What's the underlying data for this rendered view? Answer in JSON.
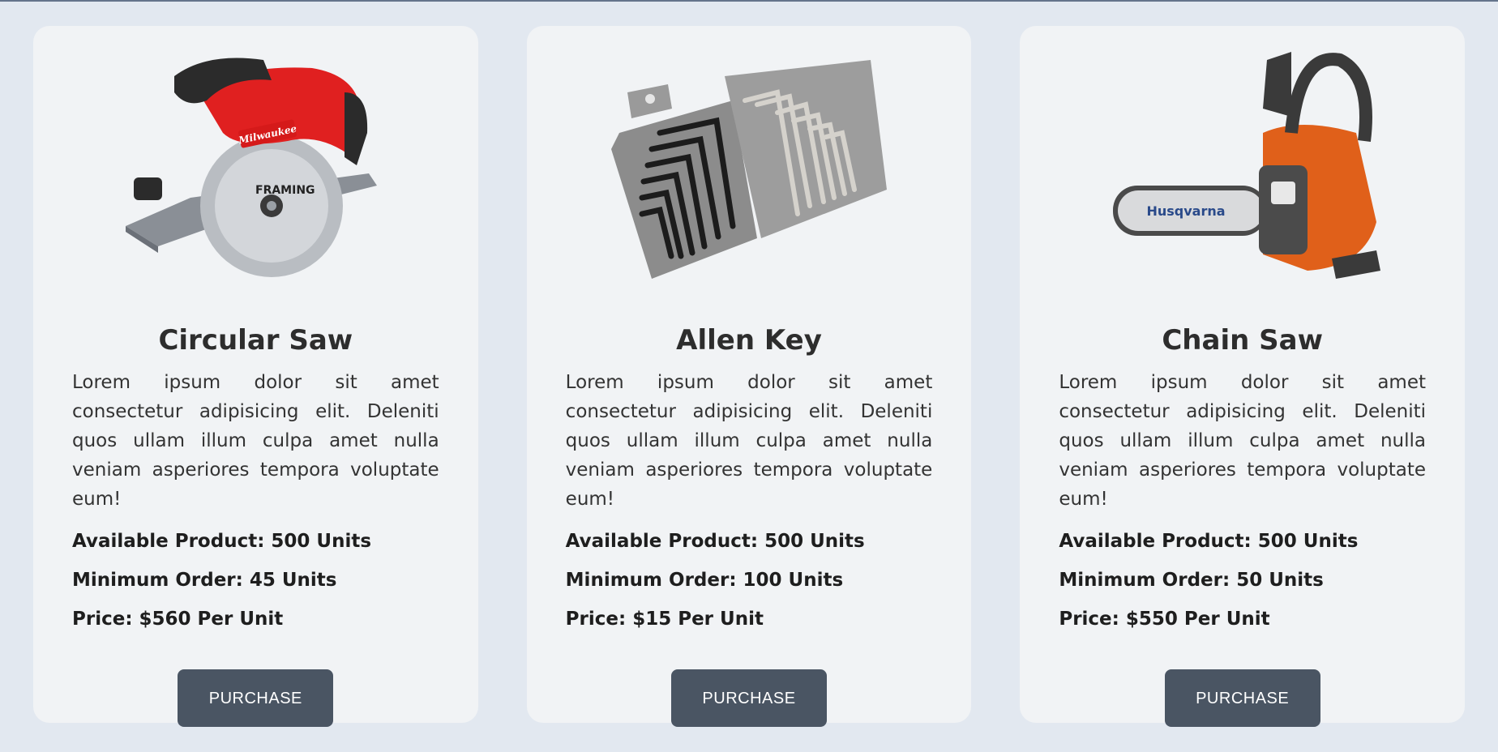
{
  "products": [
    {
      "title": "Circular Saw",
      "description": "Lorem ipsum dolor sit amet consectetur adipisicing elit. Deleniti quos ullam illum culpa amet nulla veniam asperiores tempora voluptate eum!",
      "available": "Available Product: 500 Units",
      "min_order": "Minimum Order: 45 Units",
      "price": "Price: $560 Per Unit",
      "button": "PURCHASE",
      "image_icon": "circular-saw-image",
      "brand_text": "Milwaukee"
    },
    {
      "title": "Allen Key",
      "description": "Lorem ipsum dolor sit amet consectetur adipisicing elit. Deleniti quos ullam illum culpa amet nulla veniam asperiores tempora voluptate eum!",
      "available": "Available Product: 500 Units",
      "min_order": "Minimum Order: 100 Units",
      "price": "Price: $15 Per Unit",
      "button": "PURCHASE",
      "image_icon": "allen-key-set-image"
    },
    {
      "title": "Chain Saw",
      "description": "Lorem ipsum dolor sit amet consectetur adipisicing elit. Deleniti quos ullam illum culpa amet nulla veniam asperiores tempora voluptate eum!",
      "available": "Available Product: 500 Units",
      "min_order": "Minimum Order: 50 Units",
      "price": "Price: $550 Per Unit",
      "button": "PURCHASE",
      "image_icon": "chainsaw-image",
      "brand_text": "Husqvarna"
    }
  ],
  "colors": {
    "page_bg": "#e2e8f0",
    "card_bg": "#f1f3f5",
    "button_bg": "#4a5563",
    "button_text": "#ffffff"
  }
}
